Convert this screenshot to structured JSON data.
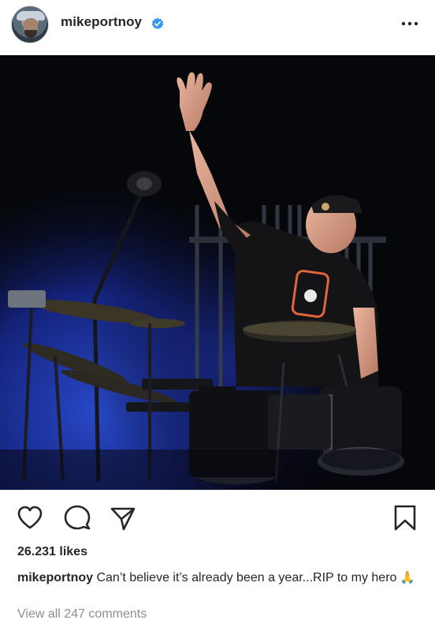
{
  "post": {
    "username": "mikeportnoy",
    "verified_icon": "verified-badge-icon",
    "more_icon": "more-options-icon"
  },
  "photo": {
    "description_icon": "concert-drummer-photo"
  },
  "actions": {
    "like_icon": "heart-icon",
    "comment_icon": "comment-icon",
    "share_icon": "send-icon",
    "save_icon": "bookmark-icon"
  },
  "likes": {
    "text": "26.231 likes"
  },
  "caption": {
    "username": "mikeportnoy",
    "text": "Can’t believe it’s already been a year...RIP to my hero",
    "emoji": "🙏"
  },
  "comments": {
    "view_all": "View all 247 comments"
  },
  "colors": {
    "text": "#262626",
    "muted": "#8e8e8e",
    "verified": "#3897f0",
    "stage_blue": "#1f3fb0"
  }
}
